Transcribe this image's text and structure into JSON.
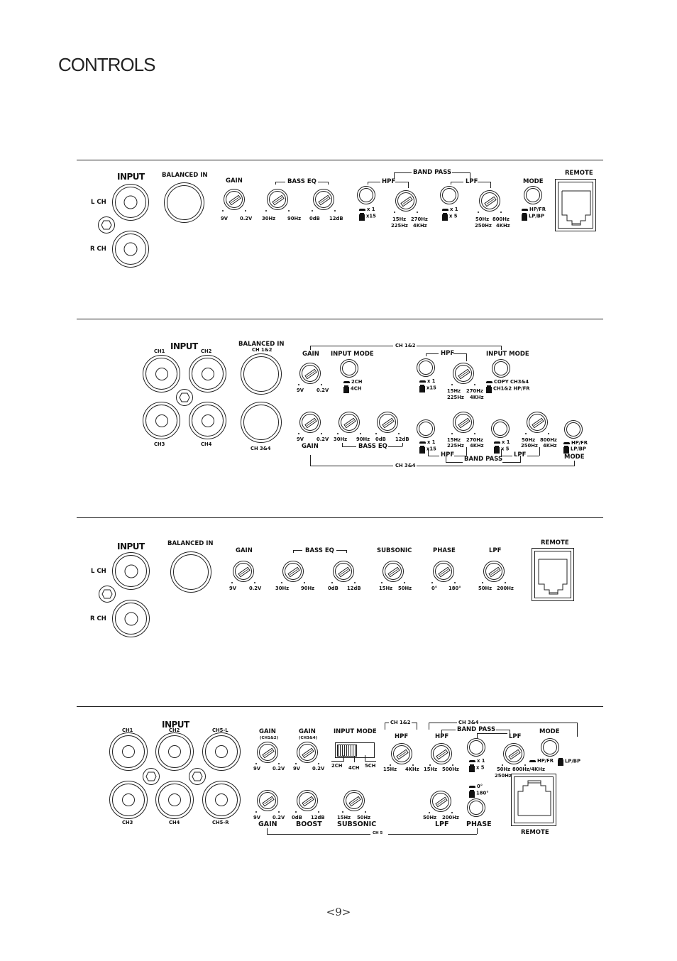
{
  "page": {
    "title": "CONTROLS",
    "page_number": "<9>"
  },
  "panel1": {
    "input": "INPUT",
    "balanced_in": "BALANCED IN",
    "l_ch": "L CH",
    "r_ch": "R CH",
    "gain": {
      "label": "GAIN",
      "min": "9V",
      "max": "0.2V"
    },
    "bass_eq": {
      "label": "BASS EQ",
      "freq_min": "30Hz",
      "freq_max": "90Hz",
      "level_min": "0dB",
      "level_max": "12dB"
    },
    "band_pass": "BAND PASS",
    "hpf": {
      "label": "HPF",
      "sw_up": "x 1",
      "sw_down": "x15",
      "min": "15Hz",
      "min2": "225Hz",
      "max": "270Hz",
      "max2": "4KHz"
    },
    "lpf": {
      "label": "LPF",
      "sw_up": "x 1",
      "sw_down": "x 5",
      "min": "50Hz",
      "min2": "250Hz",
      "max": "800Hz",
      "max2": "4KHz"
    },
    "mode": {
      "label": "MODE",
      "sw_up": "HP/FR",
      "sw_down": "LP/BP"
    },
    "remote": "REMOTE"
  },
  "panel2": {
    "input": "INPUT",
    "ch1": "CH1",
    "ch2": "CH2",
    "ch3": "CH3",
    "ch4": "CH4",
    "balanced_in": "BALANCED IN",
    "ch12": "CH 1&2",
    "ch34": "CH 3&4",
    "top": {
      "group": "CH 1&2",
      "gain": {
        "label": "GAIN",
        "min": "9V",
        "max": "0.2V"
      },
      "input_mode": {
        "label": "INPUT MODE",
        "sw_up": "2CH",
        "sw_down": "4CH"
      },
      "hpf": {
        "label": "HPF",
        "sw_up": "x 1",
        "sw_down": "x15",
        "min": "15Hz",
        "min2": "225Hz",
        "max": "270Hz",
        "max2": "4KHz"
      },
      "input_mode2": {
        "label": "INPUT MODE",
        "sw_up": "COPY CH3&4",
        "sw_down": "CH1&2 HP/FR"
      }
    },
    "bottom": {
      "group": "CH 3&4",
      "gain": {
        "label": "GAIN",
        "min": "9V",
        "max": "0.2V"
      },
      "bass_eq": {
        "label": "BASS EQ",
        "freq_min": "30Hz",
        "freq_max": "90Hz",
        "level_min": "0dB",
        "level_max": "12dB"
      },
      "band_pass": "BAND PASS",
      "hpf": {
        "label": "HPF",
        "sw_up": "x 1",
        "sw_down": "x15",
        "min": "15Hz",
        "min2": "225Hz",
        "max": "270Hz",
        "max2": "4KHz"
      },
      "lpf": {
        "label": "LPF",
        "sw_up": "x 1",
        "sw_down": "x 5",
        "min": "50Hz",
        "min2": "250Hz",
        "max": "800Hz",
        "max2": "4KHz"
      },
      "mode": {
        "label": "MODE",
        "sw_up": "HP/FR",
        "sw_down": "LP/BP"
      }
    }
  },
  "panel3": {
    "input": "INPUT",
    "balanced_in": "BALANCED IN",
    "l_ch": "L CH",
    "r_ch": "R CH",
    "gain": {
      "label": "GAIN",
      "min": "9V",
      "max": "0.2V"
    },
    "bass_eq": {
      "label": "BASS EQ",
      "freq_min": "30Hz",
      "freq_max": "90Hz",
      "level_min": "0dB",
      "level_max": "12dB"
    },
    "subsonic": {
      "label": "SUBSONIC",
      "min": "15Hz",
      "max": "50Hz"
    },
    "phase": {
      "label": "PHASE",
      "min": "0°",
      "max": "180°"
    },
    "lpf": {
      "label": "LPF",
      "min": "50Hz",
      "max": "200Hz"
    },
    "remote": "REMOTE"
  },
  "panel4": {
    "input": "INPUT",
    "ch1": "CH1",
    "ch2": "CH2",
    "ch5l": "CH5-L",
    "ch3": "CH3",
    "ch4": "CH4",
    "ch5r": "CH5-R",
    "gain12": {
      "label": "GAIN",
      "sub": "(CH1&2)",
      "min": "9V",
      "max": "0.2V"
    },
    "gain34": {
      "label": "GAIN",
      "sub": "(CH3&4)",
      "min": "9V",
      "max": "0.2V"
    },
    "input_mode": {
      "label": "INPUT MODE",
      "pos1": "2CH",
      "pos2": "4CH",
      "pos3": "5CH"
    },
    "ch12_group": "CH 1&2",
    "hpf12": {
      "label": "HPF",
      "min": "15Hz",
      "max": "4KHz"
    },
    "ch34_group": "CH 3&4",
    "band_pass": "BAND PASS",
    "hpf34": {
      "label": "HPF",
      "min": "15Hz",
      "max": "500Hz"
    },
    "lpf_sw": {
      "sw_up": "x 1",
      "sw_down": "x 5"
    },
    "lpf34": {
      "label": "LPF",
      "min": "50Hz",
      "min2": "250Hz",
      "max": "800Hz/4KHz"
    },
    "mode": {
      "label": "MODE",
      "sw_up": "HP/FR",
      "sw_down": "LP/BP"
    },
    "ch5_group": "CH 5",
    "gain5": {
      "label": "GAIN",
      "min": "9V",
      "max": "0.2V"
    },
    "boost": {
      "label": "BOOST",
      "min": "0dB",
      "max": "12dB"
    },
    "subsonic": {
      "label": "SUBSONIC",
      "min": "15Hz",
      "max": "50Hz"
    },
    "lpf5": {
      "label": "LPF",
      "min": "50Hz",
      "max": "200Hz"
    },
    "phase": {
      "label": "PHASE",
      "sw_up": "0°",
      "sw_down": "180°"
    },
    "remote": "REMOTE"
  }
}
